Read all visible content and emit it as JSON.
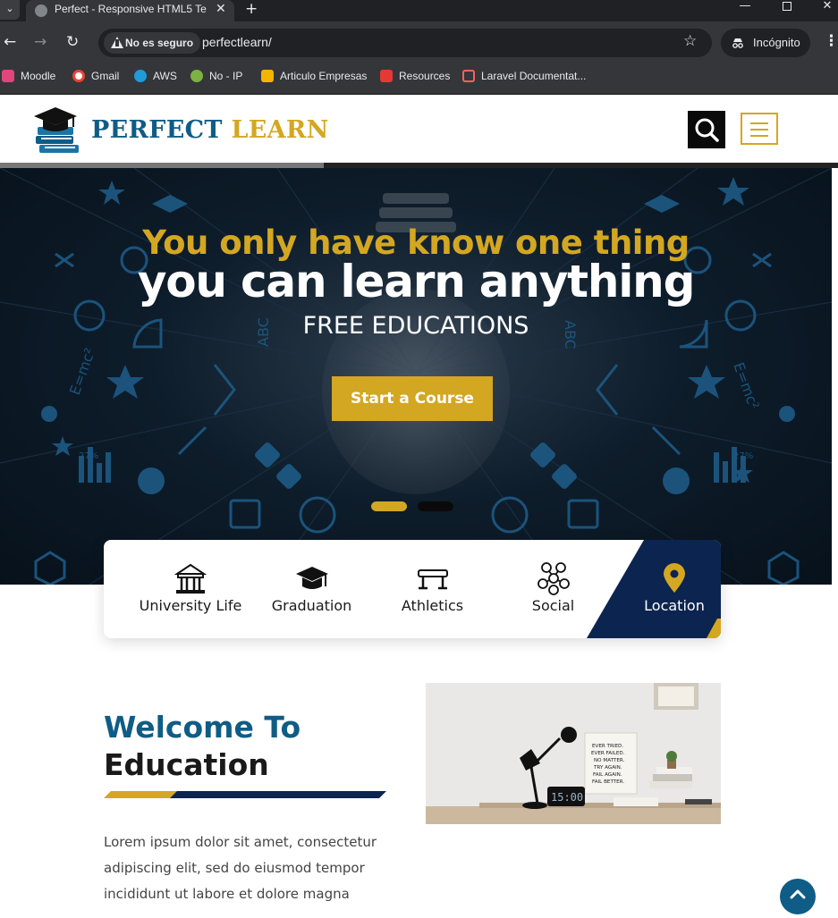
{
  "browser": {
    "tab_title": "Perfect - Responsive HTML5 Te",
    "close_glyph": "✕",
    "new_tab_glyph": "+",
    "security_label": "No es seguro",
    "url": "perfectlearn/",
    "incognito_label": "Incógnito",
    "bookmarks": [
      {
        "label": "Moodle",
        "color": "#e0457b"
      },
      {
        "label": "Gmail",
        "color": "#ea4335"
      },
      {
        "label": "AWS",
        "color": "#1f9bd7"
      },
      {
        "label": "No -  IP",
        "color": "#7cb342"
      },
      {
        "label": "Articulo Empresas",
        "color": "#f4b400"
      },
      {
        "label": "Resources",
        "color": "#e53935"
      },
      {
        "label": "Laravel Documentat...",
        "color": "#f4645f"
      }
    ]
  },
  "header": {
    "logo_part1": "PERFECT ",
    "logo_part2": "LEARN",
    "search_icon": "search-icon",
    "menu_icon": "hamburger-icon"
  },
  "hero": {
    "line1": "You only have know one thing",
    "line2": "you can learn anything",
    "line3": "FREE EDUCATIONS",
    "cta": "Start a Course",
    "slides": 2,
    "active_slide": 1
  },
  "features": [
    {
      "label": "University Life",
      "icon": "university-icon"
    },
    {
      "label": "Graduation",
      "icon": "graduation-cap-icon"
    },
    {
      "label": "Athletics",
      "icon": "athletics-icon"
    },
    {
      "label": "Social",
      "icon": "social-network-icon"
    },
    {
      "label": "Location",
      "icon": "location-pin-icon"
    }
  ],
  "welcome": {
    "title_line1": "Welcome To",
    "title_line2": "Education",
    "body": "Lorem ipsum dolor sit amet, consectetur adipiscing elit, sed do eiusmod tempor incididunt ut labore et dolore magna",
    "poster_lines": [
      "EVER TRIED.",
      "EVER FAILED.",
      "NO MATTER.",
      "TRY AGAIN.",
      "FAIL AGAIN.",
      "FAIL BETTER."
    ],
    "clock_reading": "15:00"
  },
  "colors": {
    "brand_blue": "#0f5c86",
    "brand_gold": "#d4a722",
    "navy": "#0c2450"
  }
}
